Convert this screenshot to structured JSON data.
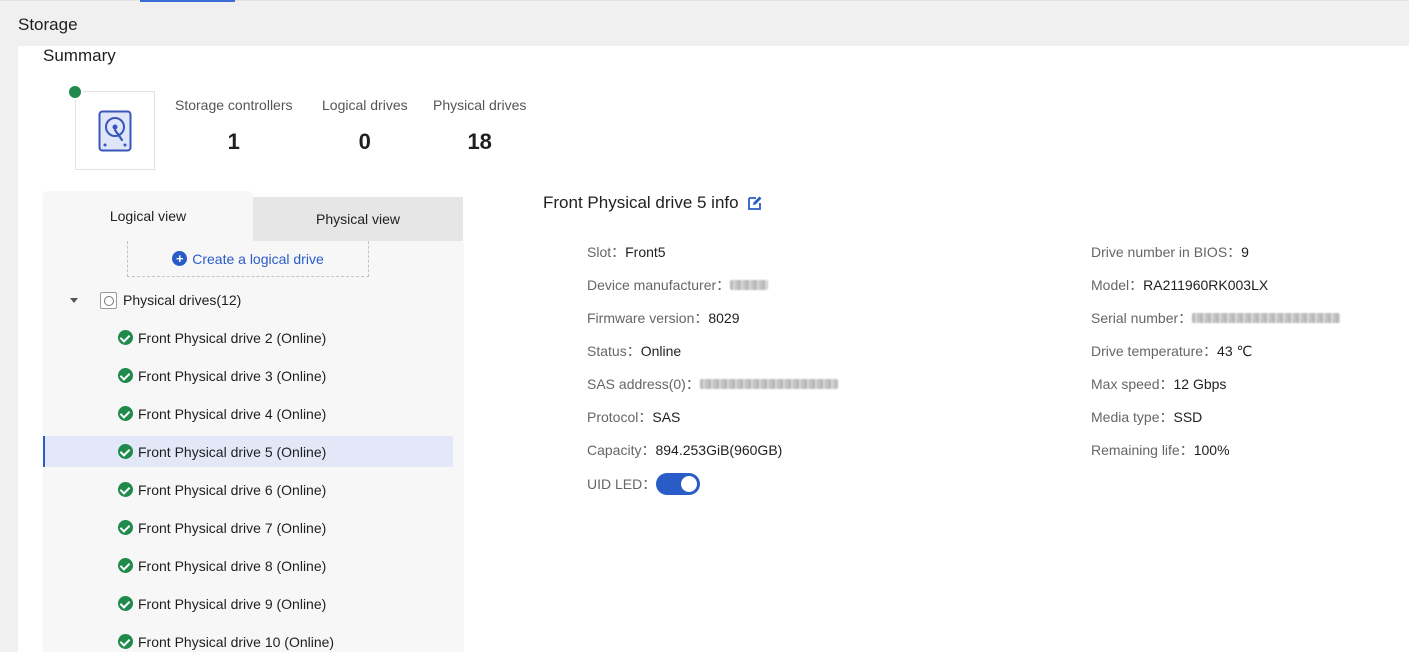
{
  "header": {
    "title": "Storage"
  },
  "summary": {
    "title": "Summary",
    "stats": [
      {
        "label": "Storage controllers",
        "value": "1"
      },
      {
        "label": "Logical drives",
        "value": "0"
      },
      {
        "label": "Physical drives",
        "value": "18"
      }
    ],
    "status_color": "#1f8a4c",
    "icon": "hard-drive-icon"
  },
  "tabs": [
    {
      "label": "Logical view",
      "active": true
    },
    {
      "label": "Physical view",
      "active": false
    }
  ],
  "tree": {
    "create_label": "Create a logical drive",
    "root_label": "Physical drives(12)",
    "items": [
      {
        "label": "Front Physical drive 2 (Online)",
        "selected": false
      },
      {
        "label": "Front Physical drive 3 (Online)",
        "selected": false
      },
      {
        "label": "Front Physical drive 4 (Online)",
        "selected": false
      },
      {
        "label": "Front Physical drive 5 (Online)",
        "selected": true
      },
      {
        "label": "Front Physical drive 6 (Online)",
        "selected": false
      },
      {
        "label": "Front Physical drive 7 (Online)",
        "selected": false
      },
      {
        "label": "Front Physical drive 8 (Online)",
        "selected": false
      },
      {
        "label": "Front Physical drive 9 (Online)",
        "selected": false
      },
      {
        "label": "Front Physical drive 10 (Online)",
        "selected": false
      }
    ]
  },
  "info": {
    "title": "Front Physical drive 5 info",
    "left": [
      {
        "label": "Slot：",
        "value": "Front5"
      },
      {
        "label": "Device manufacturer：",
        "value": "",
        "redacted": true
      },
      {
        "label": "Firmware version：",
        "value": "8029"
      },
      {
        "label": "Status：",
        "value": "Online"
      },
      {
        "label": "SAS address(0)：",
        "value": "",
        "redacted": true
      },
      {
        "label": "Protocol：",
        "value": "SAS"
      },
      {
        "label": "Capacity：",
        "value": "894.253GiB(960GB)"
      },
      {
        "label": "UID LED：",
        "value": ""
      }
    ],
    "right": [
      {
        "label": "Drive number in BIOS：",
        "value": "9"
      },
      {
        "label": "Model：",
        "value": "RA211960RK003LX"
      },
      {
        "label": "Serial number：",
        "value": "",
        "redacted": true
      },
      {
        "label": "Drive temperature：",
        "value": "43 ℃"
      },
      {
        "label": "Max speed：",
        "value": "12 Gbps"
      },
      {
        "label": "Media type：",
        "value": "SSD"
      },
      {
        "label": "Remaining life：",
        "value": "100%"
      }
    ],
    "uid_led_on": true
  },
  "colors": {
    "accent": "#2a5cc8",
    "online": "#1f8a4c"
  }
}
